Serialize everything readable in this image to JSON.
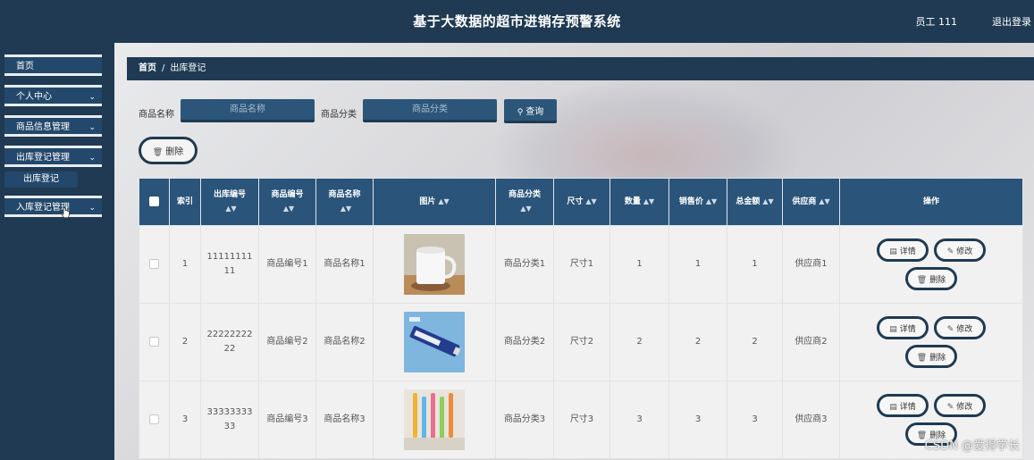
{
  "header": {
    "title": "基于大数据的超市进销存预警系统",
    "user": "员工 111",
    "logout": "退出登录"
  },
  "sidebar": {
    "items": [
      {
        "label": "首页",
        "chevron": ""
      },
      {
        "label": "个人中心",
        "chevron": "⌄"
      },
      {
        "label": "商品信息管理",
        "chevron": "⌄"
      },
      {
        "label": "出库登记管理",
        "chevron": "⌄"
      },
      {
        "label": "入库登记管理",
        "chevron": "⌄"
      }
    ],
    "sub_item": "出库登记"
  },
  "breadcrumb": {
    "home": "首页",
    "sep": "/",
    "current": "出库登记"
  },
  "search": {
    "name_label": "商品名称",
    "name_placeholder": "商品名称",
    "category_label": "商品分类",
    "category_placeholder": "商品分类",
    "query_label": "查询"
  },
  "toolbar": {
    "delete_label": "删除"
  },
  "table": {
    "headers": [
      "索引",
      "出库编号",
      "商品编号",
      "商品名称",
      "图片",
      "商品分类",
      "尺寸",
      "数量",
      "销售价",
      "总金额",
      "供应商",
      "操作"
    ],
    "rows": [
      {
        "index": "1",
        "out_no": "1111111111",
        "goods_no": "商品编号1",
        "goods_name": "商品名称1",
        "category": "商品分类1",
        "size": "尺寸1",
        "qty": "1",
        "price": "1",
        "total": "1",
        "supplier": "供应商1"
      },
      {
        "index": "2",
        "out_no": "2222222222",
        "goods_no": "商品编号2",
        "goods_name": "商品名称2",
        "category": "商品分类2",
        "size": "尺寸2",
        "qty": "2",
        "price": "2",
        "total": "2",
        "supplier": "供应商2"
      },
      {
        "index": "3",
        "out_no": "3333333333",
        "goods_no": "商品编号3",
        "goods_name": "商品名称3",
        "category": "商品分类3",
        "size": "尺寸3",
        "qty": "3",
        "price": "3",
        "total": "3",
        "supplier": "供应商3"
      }
    ],
    "actions": {
      "detail": "详情",
      "edit": "修改",
      "delete": "删除"
    }
  },
  "watermark": "CSDN @爱得学长",
  "colors": {
    "dark_navy": "#1f3a52",
    "header_blue": "#2a5479",
    "button_blue": "#2c5679"
  }
}
